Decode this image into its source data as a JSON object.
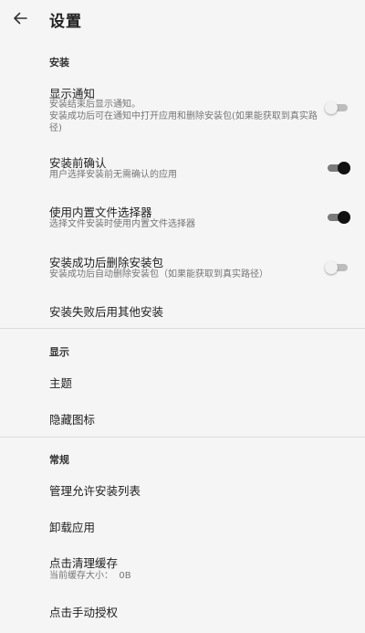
{
  "app_bar": {
    "title": "设置",
    "back_icon": "arrow-back-icon"
  },
  "sections": {
    "install": {
      "header": "安装",
      "show_notification": {
        "title": "显示通知",
        "summary": "安装结束后显示通知。\n安装成功后可在通知中打开应用和删除安装包(如果能获取到真实路径)",
        "enabled": false
      },
      "confirm_before_install": {
        "title": "安装前确认",
        "summary": "用户选择安装前无需确认的应用",
        "enabled": true
      },
      "builtin_file_picker": {
        "title": "使用内置文件选择器",
        "summary": "选择文件安装时使用内置文件选择器",
        "enabled": true
      },
      "delete_after_install": {
        "title": "安装成功后删除安装包",
        "summary": "安装成功后自动删除安装包（如果能获取到真实路径）",
        "enabled": false
      },
      "fallback_installer": {
        "title": "安装失败后用其他安装"
      }
    },
    "display": {
      "header": "显示",
      "theme": {
        "title": "主题"
      },
      "hide_icon": {
        "title": "隐藏图标"
      }
    },
    "general": {
      "header": "常规",
      "allowlist": {
        "title": "管理允许安装列表"
      },
      "uninstall": {
        "title": "卸载应用"
      },
      "clear_cache": {
        "title": "点击清理缓存",
        "summary": "当前缓存大小：  0B"
      },
      "manual_authorize": {
        "title": "点击手动授权"
      }
    }
  },
  "colors": {
    "background": "#f5f5f5",
    "switch_on_thumb": "#111111",
    "switch_off_thumb": "#f1f1f1",
    "divider": "#dcdcdc"
  }
}
